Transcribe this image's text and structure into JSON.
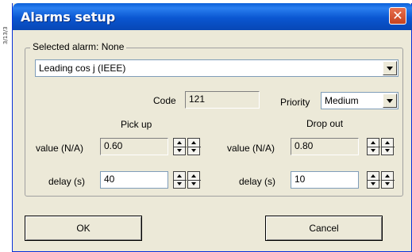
{
  "side_ref": "3/13/3",
  "window": {
    "title": "Alarms setup",
    "close_glyph": "✕"
  },
  "group": {
    "title": "Selected alarm: None",
    "alarm_select": {
      "value": "Leading cos j (IEEE)"
    }
  },
  "code": {
    "label": "Code",
    "value": "121"
  },
  "priority": {
    "label": "Priority",
    "value": "Medium"
  },
  "pickup": {
    "heading": "Pick up",
    "value_label": "value (N/A)",
    "value": "0.60",
    "delay_label": "delay (s)",
    "delay": "40"
  },
  "dropout": {
    "heading": "Drop out",
    "value_label": "value (N/A)",
    "value": "0.80",
    "delay_label": "delay (s)",
    "delay": "10"
  },
  "buttons": {
    "ok": "OK",
    "cancel": "Cancel"
  },
  "colors": {
    "titlebar": "#0a56d1",
    "close": "#c6421f",
    "face": "#ece9d8"
  }
}
